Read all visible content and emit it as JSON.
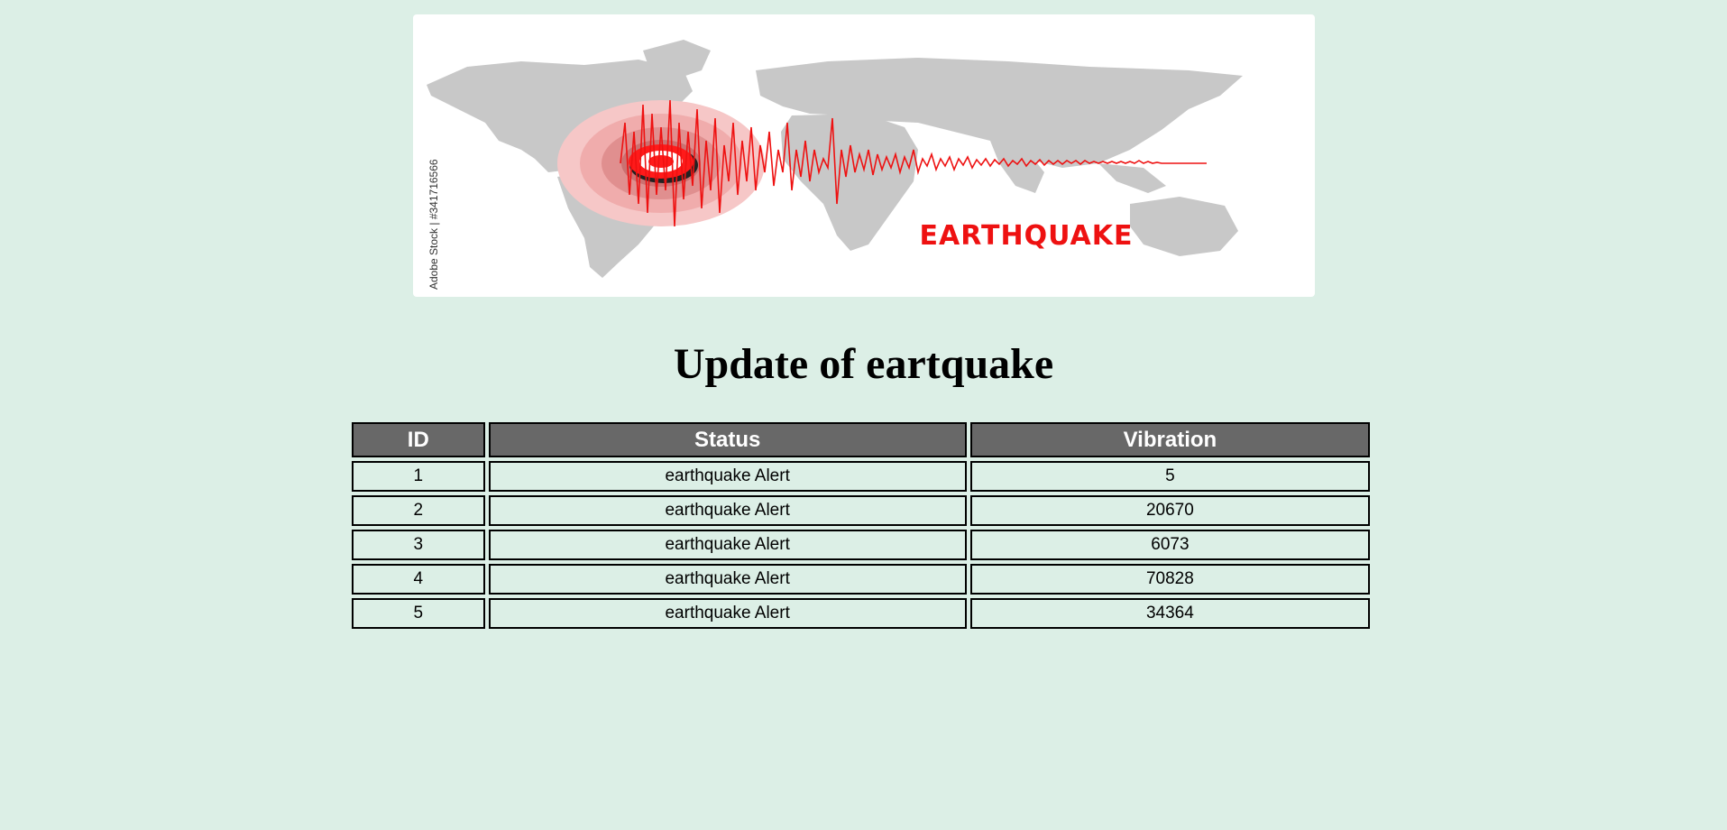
{
  "banner": {
    "caption": "EARTHQUAKE",
    "watermark": "Adobe Stock | #341716566"
  },
  "page": {
    "title": "Update of eartquake"
  },
  "table": {
    "headers": [
      "ID",
      "Status",
      "Vibration"
    ],
    "rows": [
      [
        "1",
        "earthquake Alert",
        "5"
      ],
      [
        "2",
        "earthquake Alert",
        "20670"
      ],
      [
        "3",
        "earthquake Alert",
        "6073"
      ],
      [
        "4",
        "earthquake Alert",
        "70828"
      ],
      [
        "5",
        "earthquake Alert",
        "34364"
      ]
    ]
  },
  "colors": {
    "background": "#dcefe6",
    "header_bg": "#686868",
    "alert_red": "#ee1111"
  }
}
